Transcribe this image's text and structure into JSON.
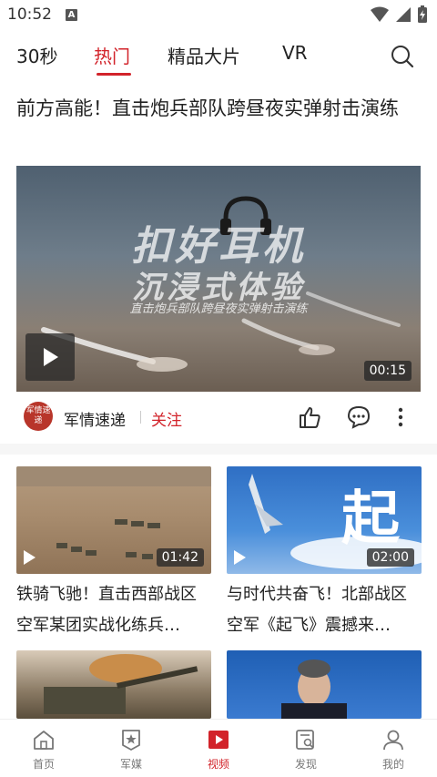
{
  "status_bar": {
    "time": "10:52",
    "notification_icon": "A"
  },
  "tabs": [
    {
      "label": "30秒"
    },
    {
      "label": "热门"
    },
    {
      "label": "精品大片"
    },
    {
      "label": "VR"
    }
  ],
  "active_tab": "热门",
  "colors": {
    "accent": "#d2232a",
    "text": "#222222",
    "muted": "#777777"
  },
  "main": {
    "title": "前方高能！直击炮兵部队跨昼夜实弹射击演练",
    "overlay_line1": "扣好耳机",
    "overlay_line2": "沉浸式体验",
    "overlay_line3": "直击炮兵部队跨昼夜实弹射击演练",
    "duration": "00:15",
    "author": {
      "name": "军情速递",
      "avatar_text": "军情速递",
      "follow_label": "关注"
    }
  },
  "grid": [
    {
      "title": "铁骑飞驰！直击西部战区空军某团实战化练兵…",
      "duration": "01:42"
    },
    {
      "title": "与时代共奋飞！北部战区空军《起飞》震撼来…",
      "duration": "02:00",
      "overlay_text": "起飞"
    },
    {
      "title": ""
    },
    {
      "title": ""
    }
  ],
  "bottom_nav": [
    {
      "label": "首页",
      "icon": "home-icon"
    },
    {
      "label": "军媒",
      "icon": "star-badge-icon"
    },
    {
      "label": "视频",
      "icon": "video-play-icon"
    },
    {
      "label": "发现",
      "icon": "discover-icon"
    },
    {
      "label": "我的",
      "icon": "user-icon"
    }
  ],
  "active_nav": "视频"
}
